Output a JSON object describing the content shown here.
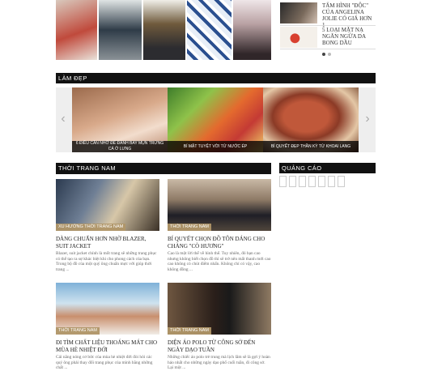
{
  "top_news": [
    {
      "title": "TẤM HÌNH \"ĐỘC\" CỦA ANGELINA JOLIE CÓ GIÁ HƠN 1"
    },
    {
      "title": "5 LOẠI MẶT NẠ NGĂN NGỪA DA BONG DẦU"
    }
  ],
  "sections": {
    "beauty": "LÀM ĐẸP",
    "men_fashion": "THỜI TRANG NAM",
    "ads": "QUẢNG CÁO"
  },
  "carousel": {
    "prev_icon": "‹",
    "next_icon": "›",
    "slides": [
      {
        "caption": "6 ĐIỀU CẦN NHỚ ĐỂ ĐÁNH BAY MỤN TRỨNG CÁ Ở LƯNG"
      },
      {
        "caption": "BÍ MẬT TUYỆT VỜI TỪ NƯỚC ÉP"
      },
      {
        "caption": "BÍ QUYẾT ĐẸP THẦN KỲ TỪ KHOAI LANG"
      }
    ]
  },
  "articles": [
    {
      "tag": "XU HƯỚNG THỜI TRANG NAM",
      "title": "DÀNG CHUẨN HƠN NHỜ BLAZER, SUIT JACKET",
      "excerpt": "Blazer, suit jacket chính là mốt trang sẽ những trang phục có thể tạo ra sự khác biệt khi cho phong cách của bạn. Trong bộ đồ của một quý ông chuẩn mực với giúp thời trang ..."
    },
    {
      "tag": "THỜI TRANG NAM",
      "title": "BÍ QUYẾT CHỌN ĐỒ TÔN DÁNG CHO CHÀNG \"CÒ HƯƠNG\"",
      "excerpt": "Cao là một lời thế về hình thể. Tuy nhiên, đó bạn cao nhưng không biết chọn đồ thì sẽ trở nên mất thanh mới cao cao không có chút điểm nhấn. Không chỉ có vậy, cao không đồng ..."
    },
    {
      "tag": "THỜI TRANG NAM",
      "title": "ĐI TÌM CHẤT LIỆU THOÁNG MÁT CHO MÙA HÈ NHIỆT ĐỚI",
      "excerpt": "Cái nắng nóng cơ bức của mùa hè nhiệt đới đòi hỏi các quý ông phải thay đổi trang phục của mình bằng những chất ..."
    },
    {
      "tag": "THỜI TRANG NAM",
      "title": "DIỆN ÁO POLO TỪ CÔNG SỞ ĐẾN NGÀY DẠO TUẦN",
      "excerpt": "Những chiếc áo polo trẻ trung mà lịch lãm sẽ là gợi ý hoàn hảo nhất cho những ngày dạo phố cuối tuần, đi công sở. Lại một ..."
    }
  ],
  "colors": {
    "header_bg": "#111111",
    "tag_bg": "#b09668"
  }
}
